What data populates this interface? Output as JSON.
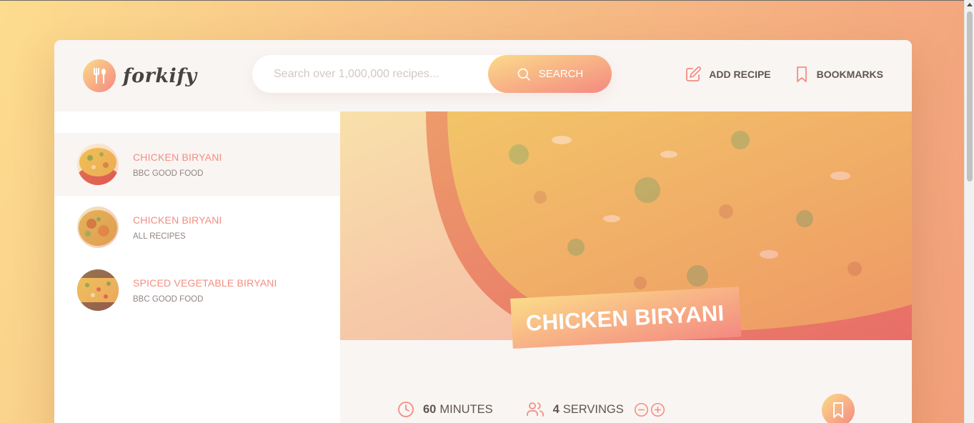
{
  "app": {
    "name": "forkify"
  },
  "search": {
    "placeholder": "Search over 1,000,000 recipes...",
    "value": "",
    "button_label": "Search"
  },
  "nav": {
    "add_recipe_label": "Add recipe",
    "bookmarks_label": "Bookmarks"
  },
  "results": [
    {
      "title": "Chicken Biryani",
      "publisher": "BBC Good Food",
      "active": true
    },
    {
      "title": "Chicken Biryani",
      "publisher": "All Recipes",
      "active": false
    },
    {
      "title": "Spiced Vegetable Biryani",
      "publisher": "BBC Good Food",
      "active": false
    }
  ],
  "recipe": {
    "title": "Chicken Biryani",
    "cooking_time": "60",
    "cooking_time_unit": "minutes",
    "servings": "4",
    "servings_unit": "servings"
  },
  "colors": {
    "accent_start": "#fbdb89",
    "accent_end": "#f48982",
    "text": "#615551",
    "muted": "#918581",
    "panel": "#f9f5f3"
  },
  "icons": [
    "fork-spoon-icon",
    "search-icon",
    "edit-icon",
    "bookmark-icon",
    "clock-icon",
    "users-icon",
    "minus-circle-icon",
    "plus-circle-icon"
  ]
}
